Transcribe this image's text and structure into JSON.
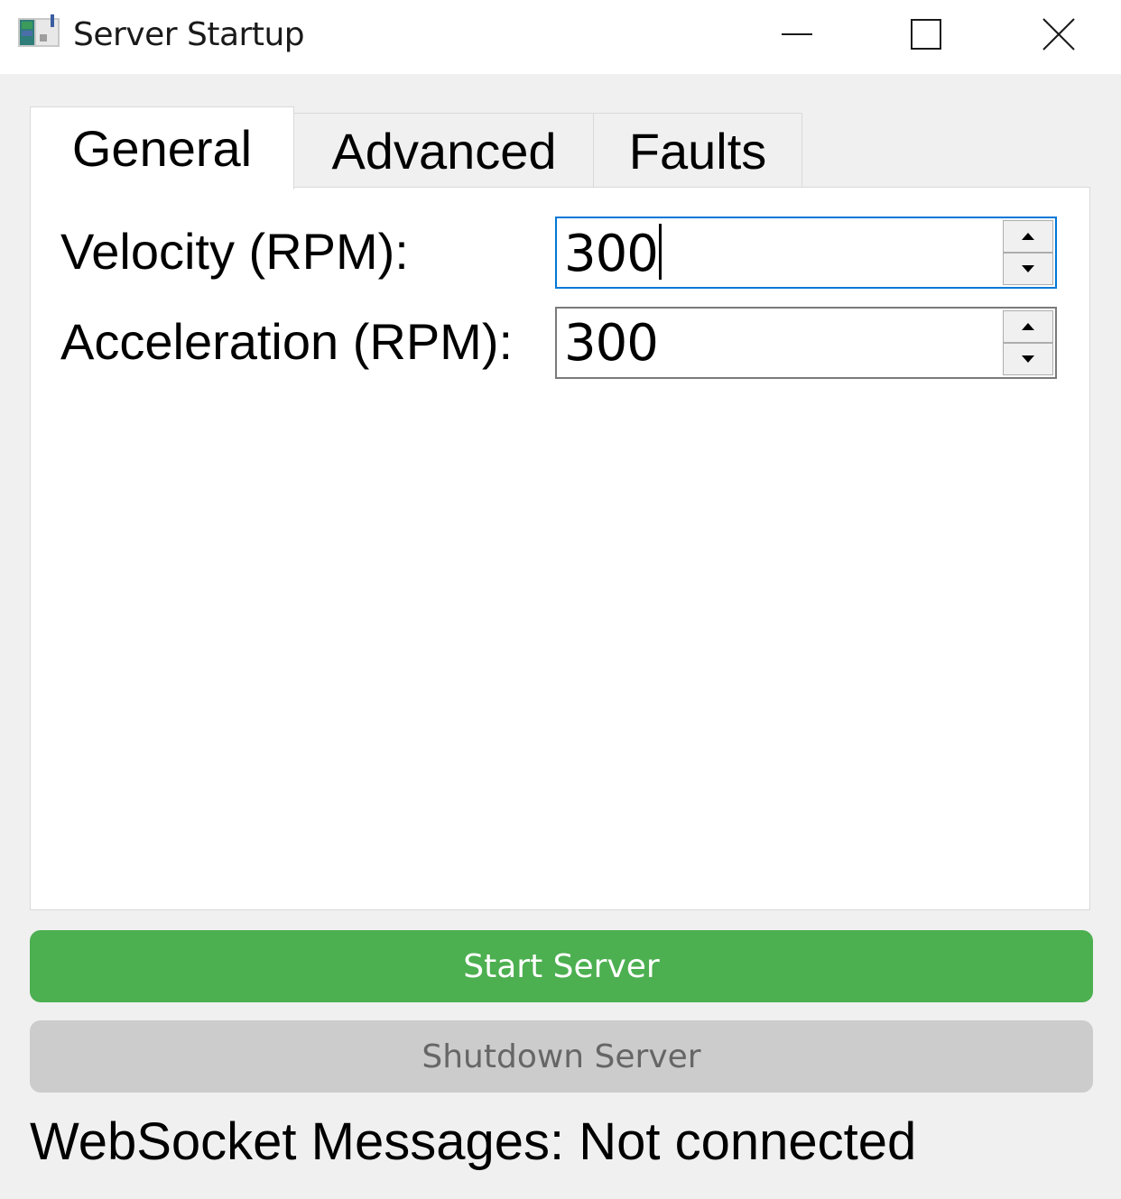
{
  "window": {
    "title": "Server Startup"
  },
  "tabs": [
    {
      "label": "General",
      "active": true
    },
    {
      "label": "Advanced",
      "active": false
    },
    {
      "label": "Faults",
      "active": false
    }
  ],
  "general": {
    "velocity": {
      "label": "Velocity (RPM):",
      "value": "300",
      "focused": true
    },
    "acceleration": {
      "label": "Acceleration (RPM):",
      "value": "300",
      "focused": false
    }
  },
  "buttons": {
    "start_label": "Start Server",
    "shutdown_label": "Shutdown Server",
    "shutdown_enabled": false
  },
  "status": {
    "text": "WebSocket Messages: Not connected"
  },
  "colors": {
    "start_button": "#4caf50",
    "shutdown_button_disabled": "#cccccc",
    "focus_border": "#0078d7"
  },
  "icons": {
    "app": "app-icon",
    "minimize": "minimize-icon",
    "maximize": "maximize-icon",
    "close": "close-icon",
    "spin_up": "arrow-up-icon",
    "spin_down": "arrow-down-icon"
  }
}
